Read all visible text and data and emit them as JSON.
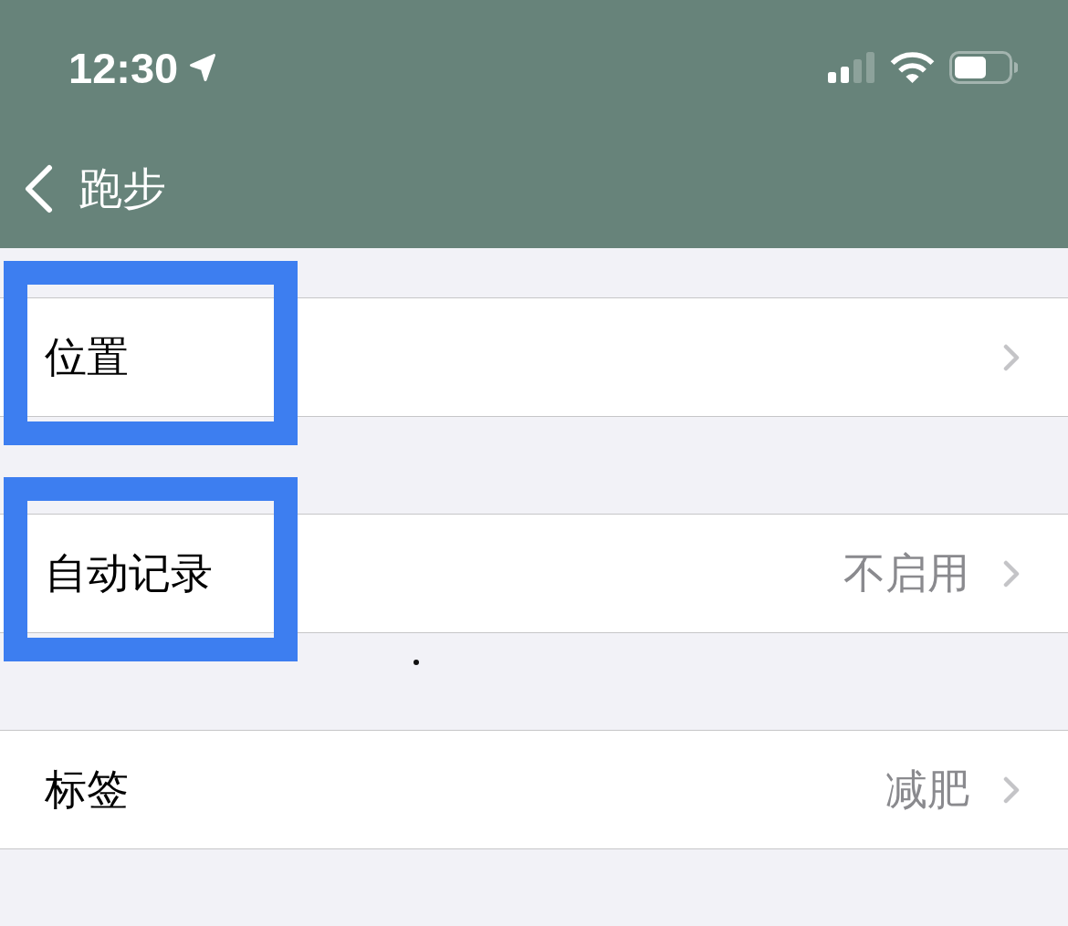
{
  "status_bar": {
    "time": "12:30"
  },
  "nav_bar": {
    "back_label": "跑步"
  },
  "groups": [
    {
      "rows": [
        {
          "label": "位置",
          "highlighted": true
        }
      ]
    },
    {
      "rows": [
        {
          "label": "自动记录",
          "value": "不启用",
          "highlighted": true
        }
      ]
    },
    {
      "rows": [
        {
          "label": "标签",
          "value": "减肥",
          "highlighted": false
        }
      ]
    }
  ]
}
